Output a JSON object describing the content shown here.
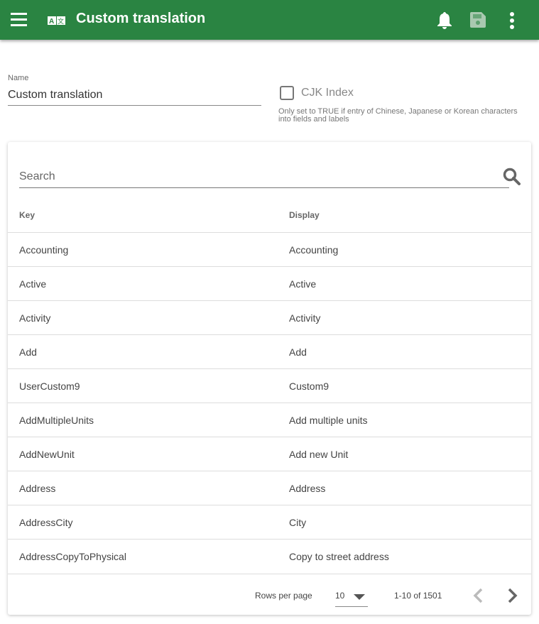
{
  "appbar": {
    "title": "Custom translation",
    "icons": [
      "menu-icon",
      "translate-icon",
      "bell-icon",
      "save-icon",
      "more-vert-icon"
    ],
    "color": "#2a8442"
  },
  "form": {
    "name_label": "Name",
    "name_value": "Custom translation",
    "cjk_label": "CJK Index",
    "cjk_checked": false,
    "cjk_hint": "Only set to TRUE if entry of Chinese, Japanese or Korean characters into fields and labels"
  },
  "table": {
    "search_placeholder": "Search",
    "columns": [
      "Key",
      "Display"
    ],
    "rows": [
      [
        "Accounting",
        "Accounting"
      ],
      [
        "Active",
        "Active"
      ],
      [
        "Activity",
        "Activity"
      ],
      [
        "Add",
        "Add"
      ],
      [
        "UserCustom9",
        "Custom9"
      ],
      [
        "AddMultipleUnits",
        "Add multiple units"
      ],
      [
        "AddNewUnit",
        "Add new Unit"
      ],
      [
        "Address",
        "Address"
      ],
      [
        "AddressCity",
        "City"
      ],
      [
        "AddressCopyToPhysical",
        "Copy to street address"
      ]
    ],
    "footer": {
      "rows_per_page_label": "Rows per page",
      "rows_per_page": "10",
      "range": "1-10 of 1501"
    }
  }
}
